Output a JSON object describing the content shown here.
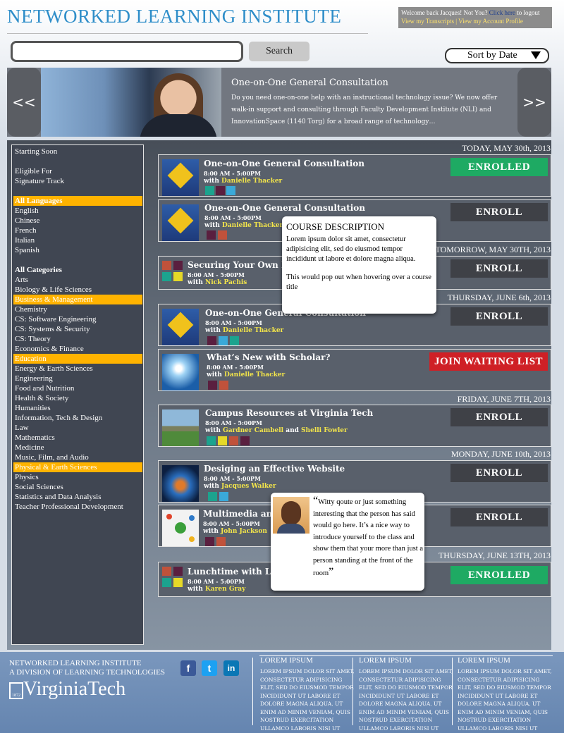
{
  "header": {
    "site_title": "NETWORKED LEARNING INSTITUTE",
    "welcome_text": "Welcome back Jacques! Not You?",
    "logout_link": "Click here",
    "logout_suffix": "to logout",
    "transcripts_link": "View my Transcripts",
    "separator": "|",
    "account_link": "View my Account Profile"
  },
  "search": {
    "placeholder": "",
    "button_label": "Search"
  },
  "sort": {
    "selected": "Sort by Date"
  },
  "banner": {
    "prev_label": "<<",
    "next_label": ">>",
    "title": "One-on-One General Consultation",
    "description": "Do you need one-on-one help with an instructional technology issue? We now offer walk-in support and consulting through Faculty Development Institute (NLI) and InnovationSpace (1140 Torg) for a broad range of technology…"
  },
  "sidebar": {
    "items": [
      {
        "label": "Starting Soon",
        "selected": false
      },
      {
        "label": "Eligible For",
        "selected": false
      },
      {
        "label": "Signature Track",
        "selected": false
      },
      {
        "label": "All Languages",
        "selected": true
      },
      {
        "label": "English",
        "selected": false
      },
      {
        "label": "Chinese",
        "selected": false
      },
      {
        "label": "French",
        "selected": false
      },
      {
        "label": "Italian",
        "selected": false
      },
      {
        "label": "Spanish",
        "selected": false
      },
      {
        "label": "All Categories",
        "selected": false
      },
      {
        "label": "Arts",
        "selected": false
      },
      {
        "label": "Biology & Life Sciences",
        "selected": false
      },
      {
        "label": "Business & Management",
        "selected": true
      },
      {
        "label": "Chemistry",
        "selected": false
      },
      {
        "label": "CS: Software Engineering",
        "selected": false
      },
      {
        "label": "CS: Systems & Security",
        "selected": false
      },
      {
        "label": "CS: Theory",
        "selected": false
      },
      {
        "label": "Economics & Finance",
        "selected": false
      },
      {
        "label": "Education",
        "selected": true
      },
      {
        "label": "Energy & Earth Sciences",
        "selected": false
      },
      {
        "label": "Engineering",
        "selected": false
      },
      {
        "label": "Food and Nutrition",
        "selected": false
      },
      {
        "label": "Health & Society",
        "selected": false
      },
      {
        "label": "Humanities",
        "selected": false
      },
      {
        "label": "Information, Tech & Design",
        "selected": false
      },
      {
        "label": "Law",
        "selected": false
      },
      {
        "label": "Mathematics",
        "selected": false
      },
      {
        "label": "Medicine",
        "selected": false
      },
      {
        "label": "Music, Film, and Audio",
        "selected": false
      },
      {
        "label": "Physical & Earth Sciences",
        "selected": true
      },
      {
        "label": "Physics",
        "selected": false
      },
      {
        "label": "Social Sciences",
        "selected": false
      },
      {
        "label": "Statistics and Data Analysis",
        "selected": false
      },
      {
        "label": "Teacher Professional Development",
        "selected": false
      }
    ]
  },
  "dates": [
    "TODAY, MAY 30th, 2013",
    "TOMORROW, MAY 30TH, 2013",
    "THURSDAY, JUNE 6th, 2013",
    "FRIDAY, JUNE 7TH, 2013",
    "MONDAY, JUNE 10th, 2013",
    "THURSDAY, JUNE 13TH, 2013"
  ],
  "with_label": "with",
  "and_label": "and",
  "courses": [
    {
      "title": "One-on-One General Consultation",
      "time": "8:00 AM - 5:00PM",
      "instructor": "Danielle Thacker",
      "action": "ENROLLED"
    },
    {
      "title": "One-on-One General Consultation",
      "time": "8:00 AM - 5:00PM",
      "instructor": "Danielle Thacker",
      "action": "ENROLL"
    },
    {
      "title": "Securing Your Own M",
      "time": "8:00 AM - 5:00PM",
      "instructor": "Nick Pachis",
      "action": "ENROLL"
    },
    {
      "title": "One-on-One General Consultation",
      "time": "8:00 AM - 5:00PM",
      "instructor": "Danielle Thacker",
      "action": "ENROLL"
    },
    {
      "title": "What’s New with Scholar?",
      "time": "8:00 AM - 5:00PM",
      "instructor": "Danielle Thacker",
      "action": "JOIN WAITING LIST"
    },
    {
      "title": "Campus Resources at Virginia Tech",
      "time": "8:00 AM - 5:00PM",
      "instructor": "Gardner Cambell",
      "instructor2": "Shelli Fowler",
      "action": "ENROLL"
    },
    {
      "title": "Desiging an Effective Website",
      "time": "8:00 AM - 5:00PM",
      "instructor": "Jacques Walker",
      "action": "ENROLL"
    },
    {
      "title": "Multimedia and",
      "time": "8:00 AM - 5:00PM",
      "instructor": "John Jackson",
      "action": "ENROLL"
    },
    {
      "title": "Lunchtime with Lea",
      "time": "8:00 AM - 5:00PM",
      "instructor": "Karen Gray",
      "action": "ENROLLED"
    }
  ],
  "course_popup": {
    "heading": "COURSE DESCRIPTION",
    "body": "Lorem ipsum dolor sit amet, consectetur adipisicing elit, sed do eiusmod tempor incididunt ut labore et dolore magna aliqua.",
    "note": "This would pop out when hovering over a course title"
  },
  "quote_popup": {
    "open_quote": "“",
    "text": "Witty qoute or just something interesting that the person has said would go here.  It’s a nice way to introduce yourself to the class and show them that your more than just a person standing at the front of the room",
    "close_quote": "”"
  },
  "footer": {
    "org_line1": "NETWORKED LEARNING INSTITUTE",
    "org_line2": "A DIVISION OF LEARNING TECHNOLOGIES",
    "logo_text": "VirginiaTech",
    "logo_year": "1872",
    "social": [
      "f",
      "t",
      "in"
    ],
    "columns": [
      {
        "heading": "LOREM IPSUM",
        "body": "LOREM IPSUM DOLOR SIT AMET, CONSECTETUR ADIPISICING ELIT, SED DO EIUSMOD TEMPOR INCIDIDUNT UT LABORE ET DOLORE MAGNA ALIQUA. UT ENIM AD MINIM VENIAM, QUIS NOSTRUD EXERCITATION ULLAMCO LABORIS NISI UT"
      },
      {
        "heading": "LOREM IPSUM",
        "body": "LOREM IPSUM DOLOR SIT AMET, CONSECTETUR ADIPISICING ELIT, SED DO EIUSMOD TEMPOR INCIDIDUNT UT LABORE ET DOLORE MAGNA ALIQUA. UT ENIM AD MINIM VENIAM, QUIS NOSTRUD EXERCITATION ULLAMCO LABORIS NISI UT"
      },
      {
        "heading": "LOREM IPSUM",
        "body": "LOREM IPSUM DOLOR SIT AMET, CONSECTETUR ADIPISICING ELIT, SED DO EIUSMOD TEMPOR INCIDIDUNT UT LABORE ET DOLORE MAGNA ALIQUA. UT ENIM AD MINIM VENIAM, QUIS NOSTRUD EXERCITATION ULLAMCO LABORIS NISI UT"
      }
    ]
  },
  "colors": {
    "brand_blue": "#2f8ec9",
    "selected_filter": "#ffb300",
    "enrolled_green": "#1eaa63",
    "waitlist_red": "#cf2026",
    "instructor_yellow": "#f4e64a"
  },
  "icons": [
    "road-sign-icon",
    "color-squares-icon",
    "facebook-icon",
    "twitter-icon",
    "linkedin-icon",
    "dropdown-triangle-icon"
  ]
}
